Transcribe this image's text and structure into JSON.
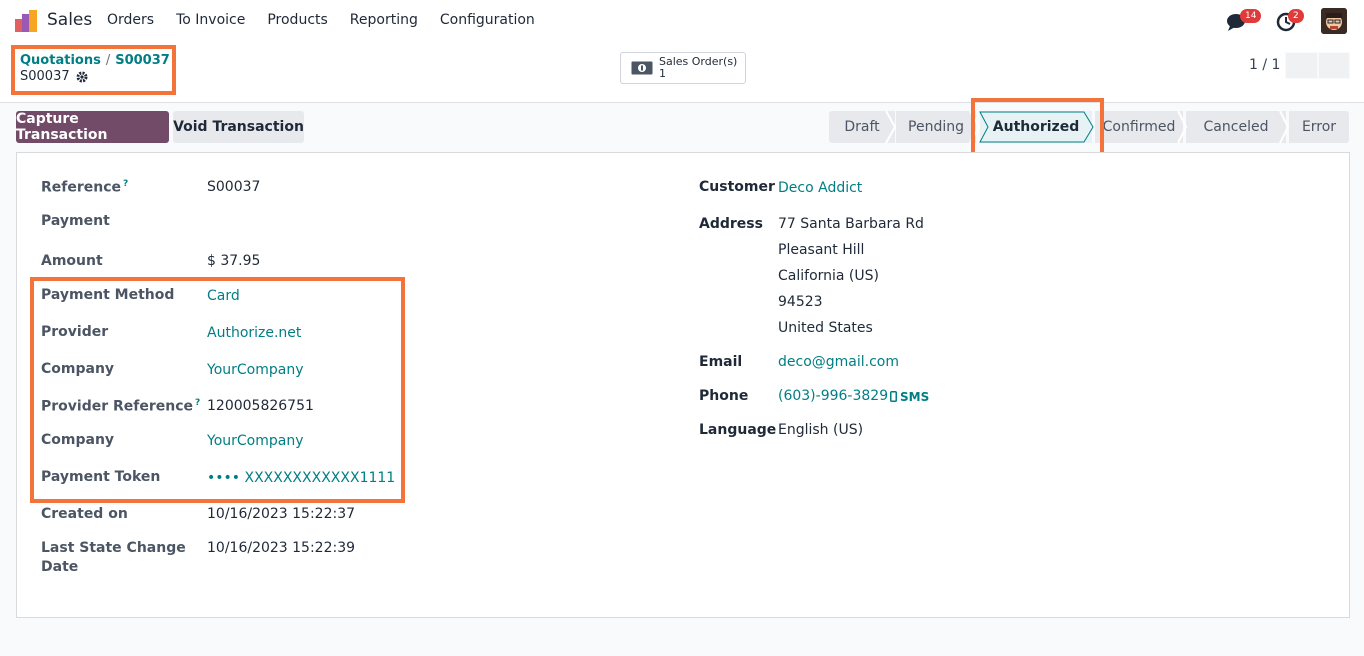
{
  "navbar": {
    "app_name": "Sales",
    "menu": [
      "Orders",
      "To Invoice",
      "Products",
      "Reporting",
      "Configuration"
    ],
    "messages_count": "14",
    "activities_count": "2"
  },
  "breadcrumb": {
    "parent": "Quotations",
    "separator": "/",
    "order": "S00037",
    "current": "S00037"
  },
  "smart_button": {
    "label": "Sales Order(s)",
    "count": "1"
  },
  "pager": {
    "text": "1 / 1"
  },
  "actions": {
    "capture": "Capture Transaction",
    "void": "Void Transaction"
  },
  "status": {
    "stages": [
      "Draft",
      "Pending",
      "Authorized",
      "Confirmed",
      "Canceled",
      "Error"
    ],
    "active": "Authorized"
  },
  "left": {
    "reference_label": "Reference",
    "reference_help": "?",
    "reference": "S00037",
    "payment_label": "Payment",
    "amount_label": "Amount",
    "amount": "$ 37.95",
    "payment_method_label": "Payment Method",
    "payment_method": "Card",
    "provider_label": "Provider",
    "provider": "Authorize.net",
    "company_label": "Company",
    "company": "YourCompany",
    "provider_reference_label": "Provider Reference",
    "provider_reference_help": "?",
    "provider_reference": "120005826751",
    "company2_label": "Company",
    "company2": "YourCompany",
    "payment_token_label": "Payment Token",
    "payment_token": "•••• XXXXXXXXXXXX1111",
    "created_on_label": "Created on",
    "created_on": "10/16/2023 15:22:37",
    "last_state_change_label_1": "Last State Change",
    "last_state_change_label_2": "Date",
    "last_state_change": "10/16/2023 15:22:39"
  },
  "right": {
    "customer_label": "Customer",
    "customer": "Deco Addict",
    "address_label": "Address",
    "address_lines": [
      "77 Santa Barbara Rd",
      "Pleasant Hill",
      "California (US)",
      "94523",
      "United States"
    ],
    "email_label": "Email",
    "email": "deco@gmail.com",
    "phone_label": "Phone",
    "phone": "(603)-996-3829",
    "sms": "SMS",
    "language_label": "Language",
    "language": "English (US)"
  },
  "colors": {
    "primary": "#714b67",
    "link": "#017e84",
    "highlight": "#f4733a",
    "badge": "#e03b3b"
  }
}
